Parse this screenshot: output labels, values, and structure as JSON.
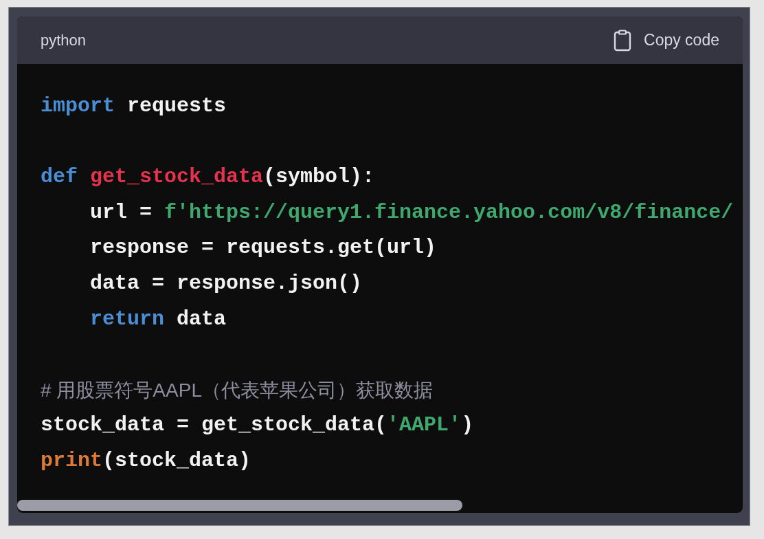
{
  "code_block": {
    "language": "python",
    "copy_button": "Copy code",
    "lines": [
      {
        "kind": "code",
        "tokens": [
          {
            "kind": "keyword",
            "text": "import"
          },
          {
            "kind": "plain",
            "text": " requests"
          }
        ]
      },
      {
        "kind": "blank"
      },
      {
        "kind": "code",
        "tokens": [
          {
            "kind": "keyword",
            "text": "def "
          },
          {
            "kind": "function",
            "text": "get_stock_data"
          },
          {
            "kind": "plain",
            "text": "(symbol):"
          }
        ]
      },
      {
        "kind": "code",
        "tokens": [
          {
            "kind": "plain",
            "text": "    url = "
          },
          {
            "kind": "string",
            "text": "f'https://query1.finance.yahoo.com/v8/finance/"
          }
        ]
      },
      {
        "kind": "code",
        "tokens": [
          {
            "kind": "plain",
            "text": "    response = requests.get(url)"
          }
        ]
      },
      {
        "kind": "code",
        "tokens": [
          {
            "kind": "plain",
            "text": "    data = response.json()"
          }
        ]
      },
      {
        "kind": "code",
        "tokens": [
          {
            "kind": "keyword",
            "text": "    return"
          },
          {
            "kind": "plain",
            "text": " data"
          }
        ]
      },
      {
        "kind": "blank"
      },
      {
        "kind": "comment",
        "tokens": [
          {
            "kind": "comment",
            "text": "# 用股票符号AAPL（代表苹果公司）获取数据"
          }
        ]
      },
      {
        "kind": "code",
        "tokens": [
          {
            "kind": "plain",
            "text": "stock_data = get_stock_data("
          },
          {
            "kind": "string",
            "text": "'AAPL'"
          },
          {
            "kind": "plain",
            "text": ")"
          }
        ]
      },
      {
        "kind": "code",
        "tokens": [
          {
            "kind": "builtin",
            "text": "print"
          },
          {
            "kind": "plain",
            "text": "(stock_data)"
          }
        ]
      }
    ]
  }
}
